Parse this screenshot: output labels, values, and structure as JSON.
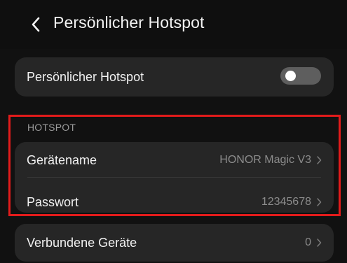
{
  "header": {
    "title": "Persönlicher Hotspot",
    "back_icon": "chevron-left-icon"
  },
  "hotspot_toggle": {
    "label": "Persönlicher Hotspot",
    "enabled": false
  },
  "hotspot_section": {
    "header": "HOTSPOT",
    "device_name": {
      "label": "Gerätename",
      "value": "HONOR Magic V3"
    },
    "password": {
      "label": "Passwort",
      "value": "12345678"
    }
  },
  "connected_devices": {
    "label": "Verbundene Geräte",
    "value": "0"
  },
  "colors": {
    "background": "#111111",
    "card": "#262626",
    "highlight": "#e31b1b",
    "toggle_off": "#5e5e5e"
  }
}
